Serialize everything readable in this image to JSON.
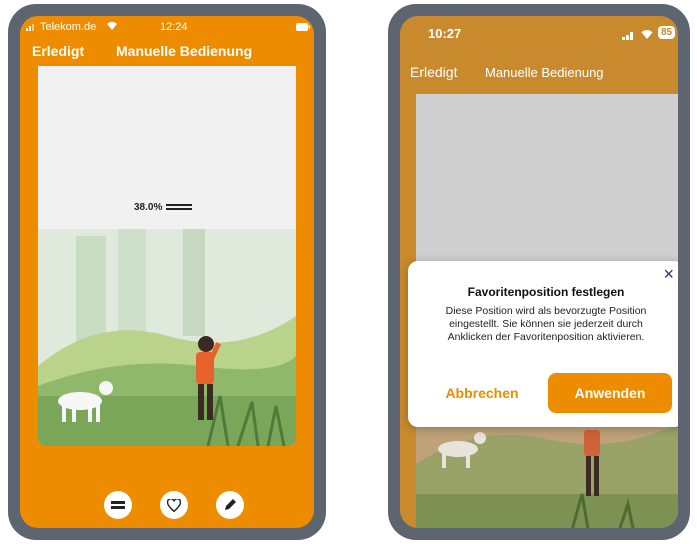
{
  "left_phone": {
    "status": {
      "carrier": "Telekom.de",
      "time": "12:24"
    },
    "nav": {
      "done": "Erledigt",
      "title": "Manuelle Bedienung"
    },
    "position_label": "38.0%",
    "bottom_actions": [
      "equals-icon",
      "heart-icon",
      "pencil-icon"
    ]
  },
  "right_phone": {
    "status": {
      "time": "10:27",
      "battery": "85"
    },
    "nav": {
      "done": "Erledigt",
      "title": "Manuelle Bedienung"
    },
    "dialog": {
      "title": "Favoritenposition festlegen",
      "body": "Diese Position wird als bevorzugte Position eingestellt. Sie können sie jederzeit durch Anklicken der Favoritenposition aktivieren.",
      "close": "×",
      "cancel": "Abbrechen",
      "apply": "Anwenden"
    }
  },
  "colors": {
    "accent": "#ee8c00",
    "frame": "#5d6670",
    "blind": "#f1f1f1"
  }
}
